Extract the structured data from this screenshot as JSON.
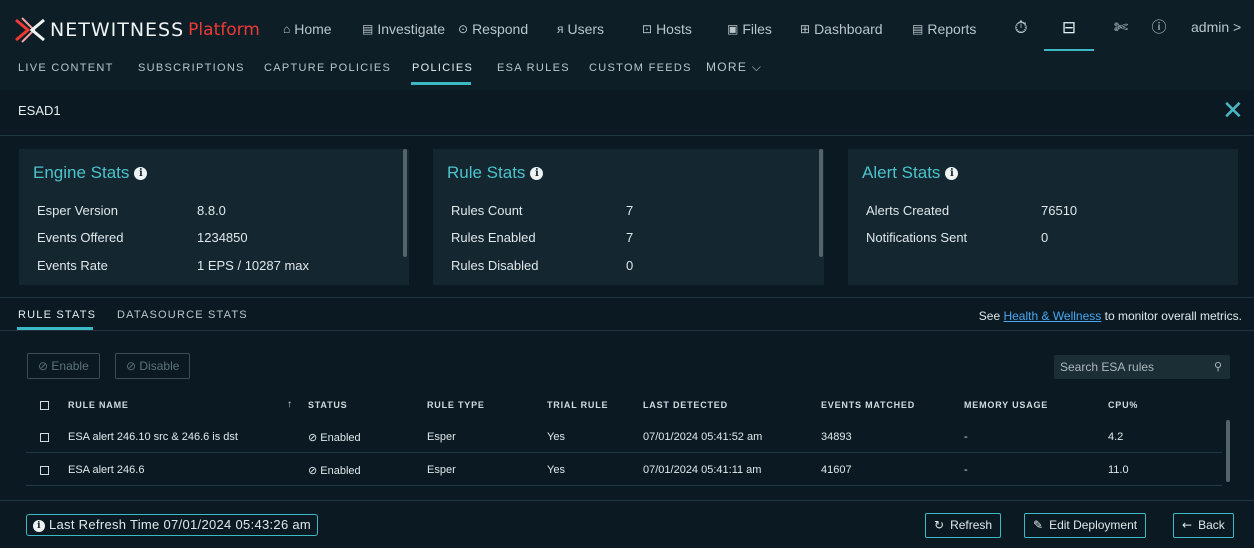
{
  "brand": {
    "name": "NETWITNESS",
    "product": "Platform"
  },
  "nav": [
    {
      "label": "Home",
      "icon": "home-icon"
    },
    {
      "label": "Investigate",
      "icon": "investigate-icon"
    },
    {
      "label": "Respond",
      "icon": "respond-icon"
    },
    {
      "label": "Users",
      "icon": "users-icon"
    },
    {
      "label": "Hosts",
      "icon": "hosts-icon"
    },
    {
      "label": "Files",
      "icon": "files-icon"
    },
    {
      "label": "Dashboard",
      "icon": "dashboard-icon"
    },
    {
      "label": "Reports",
      "icon": "reports-icon"
    }
  ],
  "user": {
    "name": "admin >"
  },
  "subnav": [
    "LIVE CONTENT",
    "SUBSCRIPTIONS",
    "CAPTURE POLICIES",
    "POLICIES",
    "ESA RULES",
    "CUSTOM FEEDS",
    "MORE ⌵"
  ],
  "title": "ESAD1",
  "engine_stats": {
    "title": "Engine Stats",
    "rows": [
      {
        "label": "Esper Version",
        "value": "8.8.0"
      },
      {
        "label": "Events Offered",
        "value": "1234850"
      },
      {
        "label": "Events Rate",
        "value": "1 EPS / 10287 max"
      }
    ]
  },
  "rule_stats": {
    "title": "Rule Stats",
    "rows": [
      {
        "label": "Rules Count",
        "value": "7"
      },
      {
        "label": "Rules Enabled",
        "value": "7"
      },
      {
        "label": "Rules Disabled",
        "value": "0"
      }
    ]
  },
  "alert_stats": {
    "title": "Alert Stats",
    "rows": [
      {
        "label": "Alerts Created",
        "value": "76510"
      },
      {
        "label": "Notifications Sent",
        "value": "0"
      }
    ]
  },
  "tabs": [
    "RULE STATS",
    "DATASOURCE STATS"
  ],
  "health": {
    "prefix": "See ",
    "link": "Health & Wellness",
    "suffix": " to monitor overall metrics."
  },
  "toolbar": {
    "enable": "Enable",
    "disable": "Disable",
    "search_placeholder": "Search ESA rules"
  },
  "columns": [
    "RULE NAME",
    "STATUS",
    "RULE TYPE",
    "TRIAL RULE",
    "LAST DETECTED",
    "EVENTS MATCHED",
    "MEMORY USAGE",
    "CPU%"
  ],
  "rows": [
    {
      "name": "ESA alert 246.10 src & 246.6 is dst",
      "status": "Enabled",
      "type": "Esper",
      "trial": "Yes",
      "last": "07/01/2024 05:41:52 am",
      "matched": "34893",
      "memory": "-",
      "cpu": "4.2"
    },
    {
      "name": "ESA alert 246.6",
      "status": "Enabled",
      "type": "Esper",
      "trial": "Yes",
      "last": "07/01/2024 05:41:11 am",
      "matched": "41607",
      "memory": "-",
      "cpu": "11.0"
    }
  ],
  "footer": {
    "last_refresh": "Last Refresh Time 07/01/2024 05:43:26 am",
    "refresh": "Refresh",
    "edit": "Edit Deployment",
    "back": "Back"
  },
  "colors": {
    "accent": "#3bb9c5",
    "brand_red": "#ee3a35",
    "background": "#0b1a22"
  }
}
